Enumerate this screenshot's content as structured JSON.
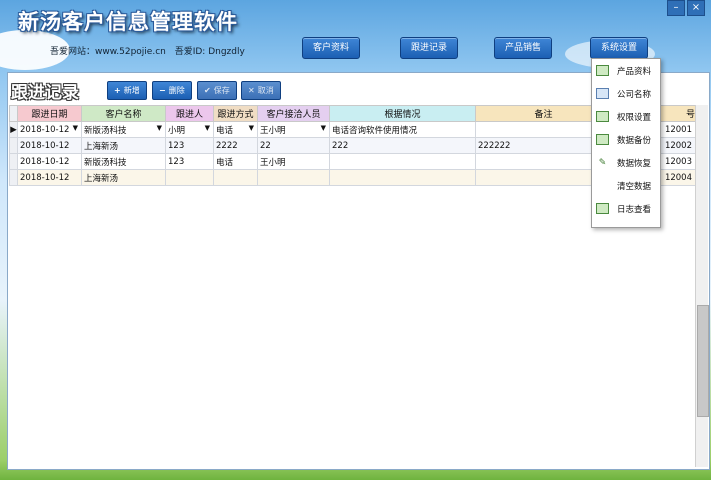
{
  "app": {
    "title": "新汤客户信息管理软件",
    "website": "吾爱网站：www.52pojie.cn",
    "user_id": "吾爱ID: Dngzdly"
  },
  "window_controls": {
    "minimize": "–",
    "close": "×"
  },
  "nav": {
    "customer": "客户资料",
    "followup": "跟进记录",
    "product_sales": "产品销售",
    "system_settings": "系统设置"
  },
  "panel": {
    "title": "跟进记录",
    "toolbar": {
      "add": "新增",
      "delete": "删除",
      "save": "保存",
      "cancel": "取消"
    }
  },
  "table": {
    "headers": [
      "跟进日期",
      "客户名称",
      "跟进人",
      "跟进方式",
      "客户接洽人员",
      "根据情况",
      "备注",
      "号"
    ],
    "header_colors": [
      "#f6c9cf",
      "#cfe9c6",
      "#ecc7ec",
      "#f0ddc4",
      "#e4cff0",
      "#c9eef2",
      "#f7e5bd",
      "#f7e5bd"
    ],
    "rows": [
      [
        "2018-10-12",
        "新版汤科技",
        "小明",
        "电话",
        "王小明",
        "电话咨询软件使用情况",
        "",
        "12001"
      ],
      [
        "2018-10-12",
        "上海新汤",
        "123",
        "2222",
        "22",
        "222",
        "222222",
        "12002"
      ],
      [
        "2018-10-12",
        "新版汤科技",
        "123",
        "电话",
        "王小明",
        "",
        "",
        "12003"
      ],
      [
        "2018-10-12",
        "上海新汤",
        "",
        "",
        "",
        "",
        "",
        "12004"
      ]
    ]
  },
  "system_menu": {
    "items": [
      {
        "label": "产品资料",
        "icon": "edit-icon"
      },
      {
        "label": "公司名称",
        "icon": "window-icon"
      },
      {
        "label": "权限设置",
        "icon": "edit-icon"
      },
      {
        "label": "数据备份",
        "icon": "edit-icon"
      },
      {
        "label": "数据恢复",
        "icon": "pencil-icon"
      },
      {
        "label": "清空数据",
        "icon": ""
      },
      {
        "label": "日志查看",
        "icon": "edit-icon"
      }
    ]
  }
}
